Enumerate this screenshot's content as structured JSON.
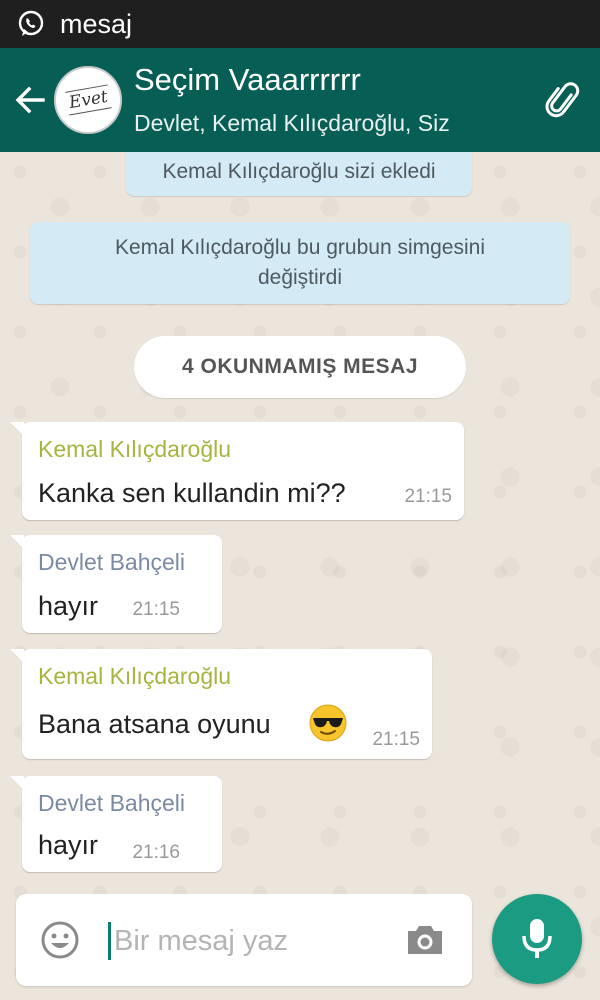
{
  "status_bar": {
    "notification_icon": "whatsapp-icon",
    "notification_text": "mesaj"
  },
  "header": {
    "back_icon": "arrow-left-icon",
    "avatar_text": "Evet",
    "title": "Seçim Vaaarrrrrr",
    "subtitle": "Devlet, Kemal Kılıçdaroğlu, Siz",
    "attach_icon": "paperclip-icon",
    "color": "#075e54"
  },
  "system_messages": [
    "Kemal Kılıçdaroğlu sizi ekledi",
    "Kemal Kılıçdaroğlu bu grubun simgesini değiştirdi"
  ],
  "system_message_icon_lines": [
    "Kemal Kılıçdaroğlu bu grubun simgesini",
    "değiştirdi"
  ],
  "unread_divider": "4 OKUNMAMIŞ MESAJ",
  "messages": [
    {
      "sender": "Kemal Kılıçdaroğlu",
      "text": "Kanka sen kullandin mi??",
      "time": "21:15",
      "sender_color": "#a7b43f"
    },
    {
      "sender": "Devlet Bahçeli",
      "text": "hayır",
      "time": "21:15",
      "sender_color": "#7b8aa3"
    },
    {
      "sender": "Kemal Kılıçdaroğlu",
      "text": "Bana atsana oyunu",
      "emoji": "sunglasses-emoji",
      "time": "21:15",
      "sender_color": "#a7b43f"
    },
    {
      "sender": "Devlet Bahçeli",
      "text": "hayır",
      "time": "21:16",
      "sender_color": "#7b8aa3"
    }
  ],
  "composer": {
    "placeholder": "Bir mesaj yaz",
    "emoji_icon": "smiley-icon",
    "camera_icon": "camera-icon",
    "mic_icon": "microphone-icon",
    "accent": "#1a9b82"
  }
}
